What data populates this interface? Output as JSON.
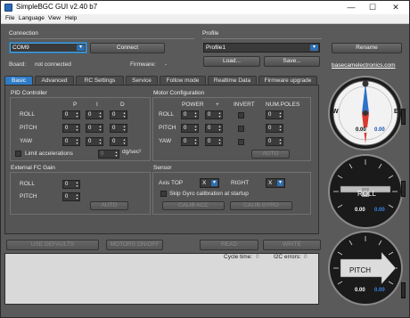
{
  "window": {
    "title": "SimpleBGC GUI v2.40 b7",
    "minimize": "—",
    "maximize": "☐",
    "close": "✕"
  },
  "menu": [
    "File",
    "Language",
    "View",
    "Help"
  ],
  "connection": {
    "section_label": "Connection",
    "port_value": "COM9",
    "connect_button": "Connect",
    "board_label": "Board:",
    "board_status": "not connected",
    "firmware_label": "Firmware:",
    "firmware_value": "-"
  },
  "profile": {
    "section_label": "Profile",
    "profile_value": "Profile1",
    "load_button": "Load...",
    "save_button": "Save...",
    "rename_button": "Rename",
    "website_link": "basecamelectronics.com"
  },
  "tabs": [
    "Basic",
    "Advanced",
    "RC Settings",
    "Service",
    "Follow mode",
    "Realtime Data",
    "Firmware upgrade"
  ],
  "pid": {
    "section_label": "PID Controller",
    "col_p": "P",
    "col_i": "I",
    "col_d": "D",
    "rows": [
      "ROLL",
      "PITCH",
      "YAW"
    ],
    "value": "0",
    "limit_label": "Limit accelerations",
    "limit_value": "0",
    "limit_unit": "dg/sec²"
  },
  "motor": {
    "section_label": "Motor Configuration",
    "col_power": "POWER",
    "col_plus": "+",
    "col_invert": "INVERT",
    "col_poles": "NUM.POLES",
    "rows": [
      "ROLL",
      "PITCH",
      "YAW"
    ],
    "value": "0",
    "auto_button": "AUTO"
  },
  "external_fc": {
    "section_label": "External FC Gain",
    "rows": [
      "ROLL",
      "PITCH"
    ],
    "value": "0",
    "auto_button": "AUTO"
  },
  "sensor": {
    "section_label": "Sensor",
    "axis_top_label": "Axis TOP",
    "axis_top_value": "X",
    "right_label": "RIGHT",
    "right_value": "X",
    "skip_gyro_label": "Skip Gyro calibration at startup",
    "calib_acc_button": "CALIB ACC",
    "calib_gyro_button": "CALIB GYRO"
  },
  "bottom_buttons": [
    "USE DEFAULTS",
    "MOTORS ON/OFF",
    "READ",
    "WRITE"
  ],
  "status": {
    "cycle_time_label": "Cycle time:",
    "cycle_time_value": "0",
    "i2c_errors_label": "I2C errors:",
    "i2c_errors_value": "0"
  },
  "gauges": {
    "compass": {
      "w": "W",
      "e": "E",
      "value1": "0.00",
      "value2": "0.00"
    },
    "roll": {
      "label": "ROLL",
      "value1": "0.00",
      "value2": "0.00"
    },
    "pitch": {
      "label": "PITCH",
      "value1": "0.00",
      "value2": "0.00"
    }
  }
}
